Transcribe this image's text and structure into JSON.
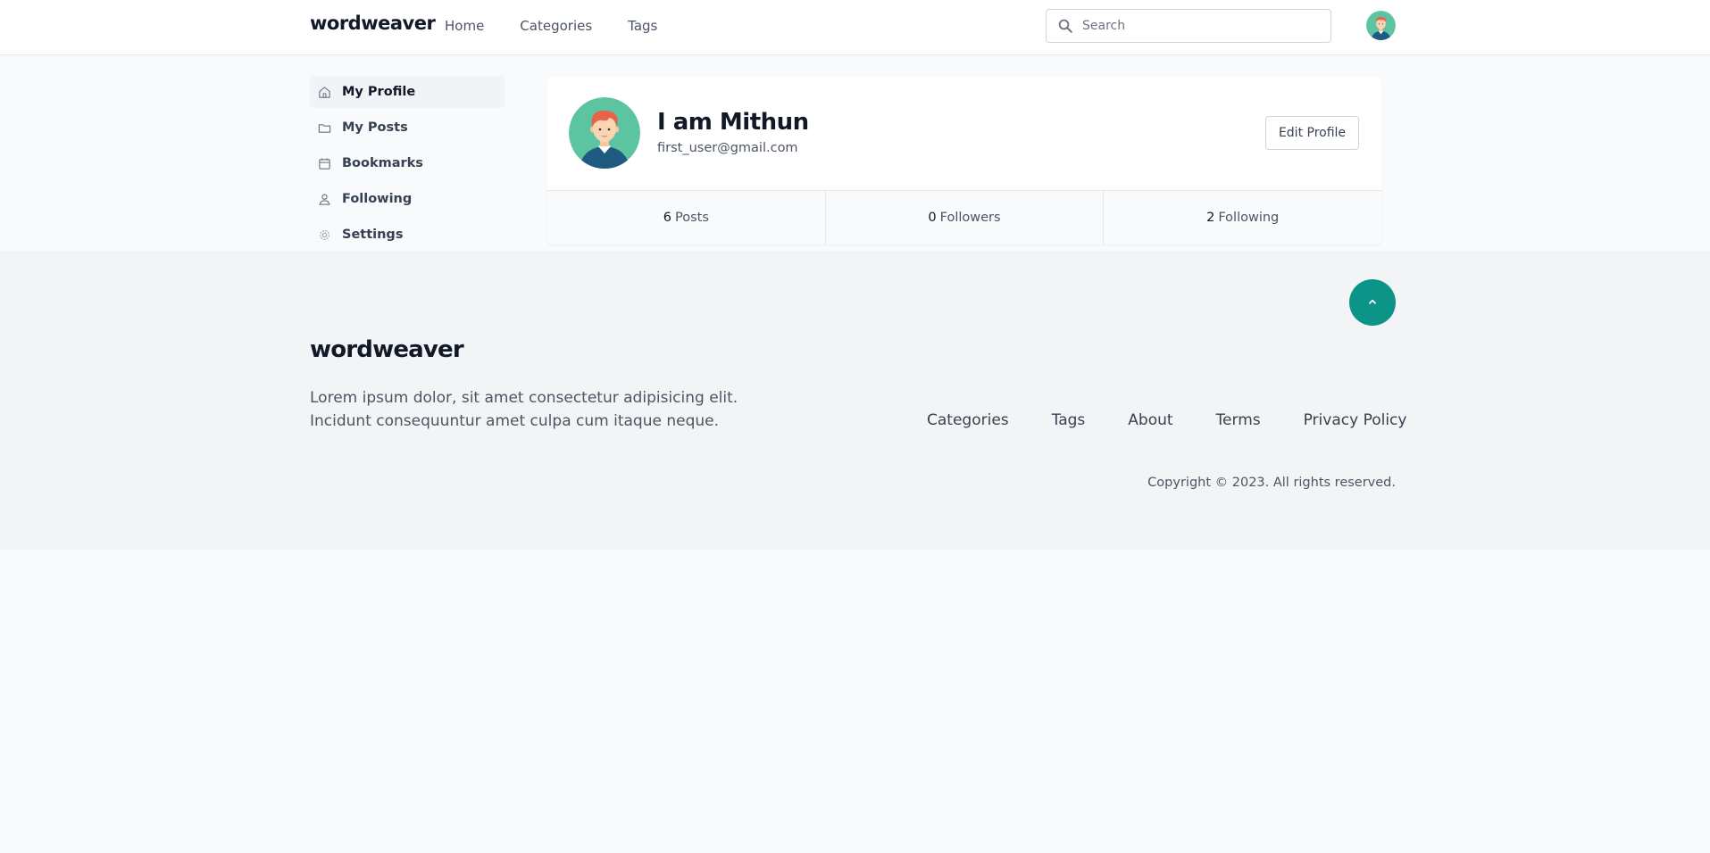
{
  "header": {
    "brand": "wordweaver",
    "nav": [
      "Home",
      "Categories",
      "Tags"
    ],
    "search_placeholder": "Search",
    "avatar_icon": "user-avatar-icon"
  },
  "sidebar": {
    "items": [
      {
        "label": "My Profile",
        "icon": "home-icon",
        "active": true
      },
      {
        "label": "My Posts",
        "icon": "folder-icon",
        "active": false
      },
      {
        "label": "Bookmarks",
        "icon": "calendar-icon",
        "active": false
      },
      {
        "label": "Following",
        "icon": "users-icon",
        "active": false
      },
      {
        "label": "Settings",
        "icon": "gear-icon",
        "active": false
      }
    ]
  },
  "profile": {
    "name": "I am Mithun",
    "email": "first_user@gmail.com",
    "edit_label": "Edit Profile",
    "stats": [
      {
        "value": "6",
        "label": "Posts"
      },
      {
        "value": "0",
        "label": "Followers"
      },
      {
        "value": "2",
        "label": "Following"
      }
    ]
  },
  "footer": {
    "brand": "wordweaver",
    "description": "Lorem ipsum dolor, sit amet consectetur adipisicing elit. Incidunt consequuntur amet culpa cum itaque neque.",
    "links": [
      "Categories",
      "Tags",
      "About",
      "Terms",
      "Privacy Policy"
    ],
    "copyright": "Copyright © 2023. All rights reserved."
  },
  "colors": {
    "accent": "#0d9488",
    "avatar_bg": "#5cc4a0"
  }
}
